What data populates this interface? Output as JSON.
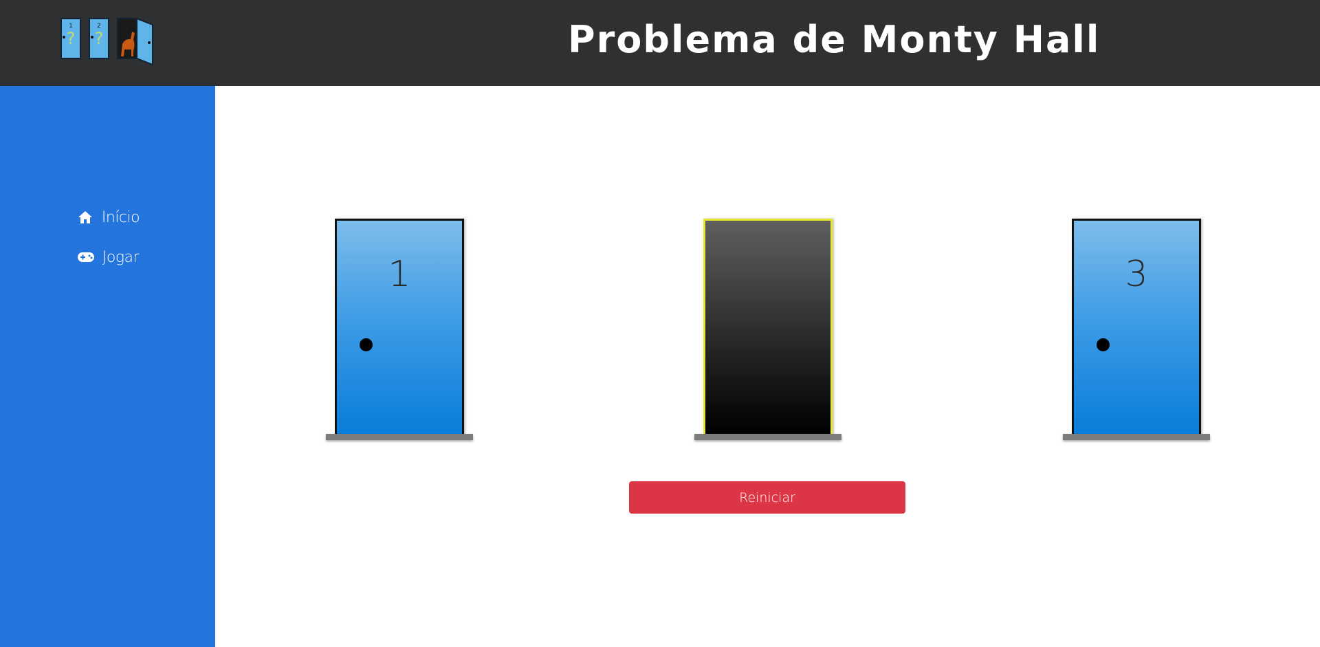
{
  "header": {
    "title": "Problema de Monty Hall",
    "logo": {
      "doors": [
        {
          "number": "1",
          "symbol": "?"
        },
        {
          "number": "2",
          "symbol": "?"
        },
        {
          "content": "goat",
          "state": "open"
        }
      ]
    }
  },
  "sidebar": {
    "items": [
      {
        "label": "Início",
        "icon": "home-icon"
      },
      {
        "label": "Jogar",
        "icon": "gamepad-icon"
      }
    ]
  },
  "game": {
    "doors": [
      {
        "number": "1",
        "state": "closed"
      },
      {
        "number": "",
        "state": "open",
        "selected": true
      },
      {
        "number": "3",
        "state": "closed"
      }
    ],
    "restart_label": "Reiniciar"
  },
  "colors": {
    "header_bg": "#2f3032",
    "sidebar_bg": "#2474de",
    "door_blue": "#1f8ae0",
    "selected_outline": "#e8e82a",
    "button_red": "#dc3545"
  }
}
